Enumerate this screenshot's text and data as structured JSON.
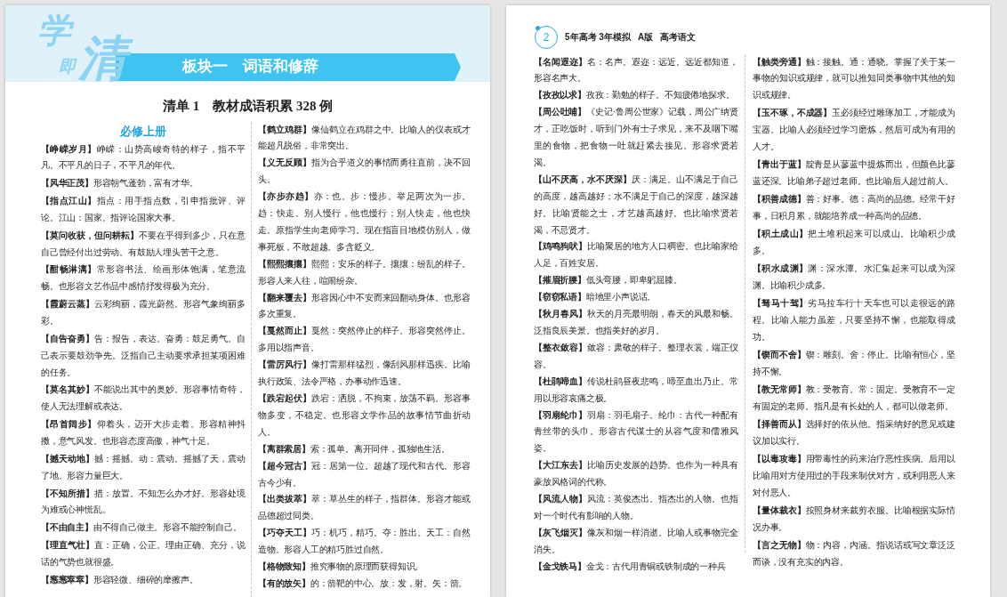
{
  "left_page": {
    "logo_text": "学即清",
    "banner": "板块一　词语和修辞",
    "list_title": "清单 1　教材成语积累 328 例",
    "columns": [
      {
        "heading": "必修上册",
        "entries": [
          {
            "term": "【峥嵘岁月】",
            "definition": "峥嵘：山势高峻奇特的样子，指不平凡。不平凡的日子，不平凡的年代。"
          },
          {
            "term": "【风华正茂】",
            "definition": "形容朝气蓬勃，富有才华。"
          },
          {
            "term": "【指点江山】",
            "definition": "指点：用手指点数，引申指批评、评论。江山：国家。指评论国家大事。"
          },
          {
            "term": "【莫问收获，但问耕耘】",
            "definition": "不要在乎得到多少，只在意自己曾经付出过劳动。有鼓励人埋头苦干之意。"
          },
          {
            "term": "【酣畅淋漓】",
            "definition": "常形容书法、绘画形体饱满，笔意流畅。也形容文艺作品中感情抒发得极为充分。"
          },
          {
            "term": "【霞蔚云蒸】",
            "definition": "云彩绚丽，霞光蔚然。形容气象绚丽多彩。"
          },
          {
            "term": "【自告奋勇】",
            "definition": "告：报告，表达。奋勇：鼓足勇气。自己表示要鼓劲争先。泛指自己主动要求承担某项困难的任务。"
          },
          {
            "term": "【莫名其妙】",
            "definition": "不能说出其中的奥妙。形容事情奇特，使人无法理解或表达。"
          },
          {
            "term": "【昂首阔步】",
            "definition": "仰着头，迈开大步走着。形容精神抖擞，意气风发。也形容态度高傲，神气十足。"
          },
          {
            "term": "【撼天动地】",
            "definition": "撼：摇撼。动：震动。摇撼了天，震动了地。形容力量巨大。"
          },
          {
            "term": "【不知所措】",
            "definition": "措：放置。不知怎么办才好。形容处境为难或心神慌乱。"
          },
          {
            "term": "【不由自主】",
            "definition": "由不得自己做主。形容不能控制自己。"
          },
          {
            "term": "【理直气壮】",
            "definition": "直：正确，公正。理由正确、充分，说话的气势也就很盛。"
          },
          {
            "term": "【窸窸窣窣】",
            "definition": "形容轻微、细碎的摩擦声。"
          }
        ]
      },
      {
        "entries": [
          {
            "term": "【鹤立鸡群】",
            "definition": "像仙鹤立在鸡群之中。比喻人的仪表或才能超凡脱俗，非常突出。"
          },
          {
            "term": "【义无反顾】",
            "definition": "指为合乎道义的事情而勇往直前，决不回头。"
          },
          {
            "term": "【亦步亦趋】",
            "definition": "亦：也。步：慢步。举足两次为一步。趋：快走。别人慢行，他也慢行；别人快走，他也快走。原指学生向老师学习。现在指盲目地模仿别人，做事死板，不敢超越。多含贬义。"
          },
          {
            "term": "【熙熙攘攘】",
            "definition": "熙熙：安乐的样子。攘攘：纷乱的样子。形容人来人往，喧闹纷杂。"
          },
          {
            "term": "【翻来覆去】",
            "definition": "形容因心中不安而来回翻动身体。也形容多次重复。"
          },
          {
            "term": "【戛然而止】",
            "definition": "戛然：突然停止的样子。形容突然停止。多用以指声音。"
          },
          {
            "term": "【雷厉风行】",
            "definition": "像打雷那样猛烈，像刮风那样迅疾。比喻执行政策、法令严格，办事动作迅速。"
          },
          {
            "term": "【跌宕起伏】",
            "definition": "跌宕：洒脱，不拘束，放荡不羁。形容事物多变，不稳定。也形容文学作品的故事情节曲折动人。"
          },
          {
            "term": "【离群索居】",
            "definition": "索：孤单。离开同伴，孤独地生活。"
          },
          {
            "term": "【超今冠古】",
            "definition": "冠：居第一位。超越了现代和古代。形容古今少有。"
          },
          {
            "term": "【出类拔萃】",
            "definition": "萃：草丛生的样子，指群体。形容才能或品德超过同类。"
          },
          {
            "term": "【巧夺天工】",
            "definition": "巧：机巧，精巧。夺：胜出。天工：自然造物。形容人工的精巧胜过自然。"
          },
          {
            "term": "【格物致知】",
            "definition": "推究事物的原理而获得知识。"
          },
          {
            "term": "【有的放矢】",
            "definition": "的：箭靶的中心。放：发，射。矢：箭。"
          }
        ]
      }
    ]
  },
  "right_page": {
    "running_head": {
      "page_number": "2",
      "series": "5年高考 3年模拟",
      "edition": "A版",
      "subject": "高考语文"
    },
    "columns": [
      {
        "entries": [
          {
            "term": "【名闻遐迩】",
            "definition": "名：名声。遐迩：远近。远近都知道，形容名声大。"
          },
          {
            "term": "【孜孜以求】",
            "definition": "孜孜：勤勉的样子。不知疲倦地探求。"
          },
          {
            "term": "【周公吐哺】",
            "definition": "《史记·鲁周公世家》记载，周公广纳贤才，正吃饭时，听到门外有士子求见，来不及咽下嘴里的食物，把食物一吐就赶紧去接见。形容求贤若渴。"
          },
          {
            "term": "【山不厌高，水不厌深】",
            "definition": "厌：满足。山不满足于自己的高度，越高越好；水不满足于自己的深度，越深越好。比喻贤能之士，才艺越高越好。也比喻求贤若渴，不忌贤才。"
          },
          {
            "term": "【鸡鸣狗吠】",
            "definition": "比喻聚居的地方人口稠密。也比喻家给人足，百姓安居。"
          },
          {
            "term": "【摧眉折腰】",
            "definition": "低头弯腰，即卑躬屈膝。"
          },
          {
            "term": "【窃窃私语】",
            "definition": "暗地里小声说话。"
          },
          {
            "term": "【秋月春风】",
            "definition": "秋天的月亮最明朗，春天的风最和畅。泛指良辰美景。也指美好的岁月。"
          },
          {
            "term": "【整衣敛容】",
            "definition": "敛容：肃敬的样子。整理衣裳，端正仪容。"
          },
          {
            "term": "【杜鹃啼血】",
            "definition": "传说杜鹃昼夜悲鸣，啼至血出乃止。常用以形容哀痛之极。"
          },
          {
            "term": "【羽扇纶巾】",
            "definition": "羽扇：羽毛扇子。纶巾：古代一种配有青丝带的头巾。形容古代谋士的从容气度和儒雅风姿。"
          },
          {
            "term": "【大江东去】",
            "definition": "比喻历史发展的趋势。也作为一种具有豪放风格词的代称。"
          },
          {
            "term": "【风流人物】",
            "definition": "风流：英俊杰出。指杰出的人物。也指对一个时代有影响的人物。"
          },
          {
            "term": "【灰飞烟灭】",
            "definition": "像灰和烟一样消逝。比喻人或事物完全消失。"
          },
          {
            "term": "【金戈铁马】",
            "definition": "金戈：古代用青铜或铁制成的一种兵"
          }
        ]
      },
      {
        "entries": [
          {
            "term": "【触类旁通】",
            "definition": "触：接触。通：通晓。掌握了关于某一事物的知识或规律，就可以推知同类事物中其他的知识或规律。"
          },
          {
            "term": "【玉不琢，不成器】",
            "definition": "玉必须经过雕琢加工，才能成为宝器。比喻人必须经过学习磨炼，然后可成为有用的人才。"
          },
          {
            "term": "【青出于蓝】",
            "definition": "靛青是从蓼蓝中提炼而出，但颜色比蓼蓝还深。比喻弟子超过老师。也比喻后人超过前人。"
          },
          {
            "term": "【积善成德】",
            "definition": "善：好事。德：高尚的品德。经常干好事，日积月累，就能培养成一种高尚的品德。"
          },
          {
            "term": "【积土成山】",
            "definition": "把土堆积起来可以成山。比喻积少成多。"
          },
          {
            "term": "【积水成渊】",
            "definition": "渊：深水潭。水汇集起来可以成为深渊。比喻积少成多。"
          },
          {
            "term": "【驽马十驾】",
            "definition": "劣马拉车行十天车也可以走很远的路程。比喻人能力虽差，只要坚持不懈，也能取得成功。"
          },
          {
            "term": "【锲而不舍】",
            "definition": "锲：雕刻。舍：停止。比喻有恒心，坚持不懈。"
          },
          {
            "term": "【教无常师】",
            "definition": "教：受教育。常：固定。受教育不一定有固定的老师。指凡是有长处的人，都可以做老师。"
          },
          {
            "term": "【择善而从】",
            "definition": "选择好的依从他。指采纳好的意见或建议加以实行。"
          },
          {
            "term": "【以毒攻毒】",
            "definition": "用带毒性的药来治疗恶性疾病。后用以比喻用对方使用过的手段来制伏对方，或利用恶人来对付恶人。"
          },
          {
            "term": "【量体裁衣】",
            "definition": "按照身材来裁剪衣服。比喻根据实际情况办事。"
          },
          {
            "term": "【言之无物】",
            "definition": "物：内容，内涵。指说话或写文章泛泛而谈，没有充实的内容。"
          }
        ]
      }
    ]
  }
}
